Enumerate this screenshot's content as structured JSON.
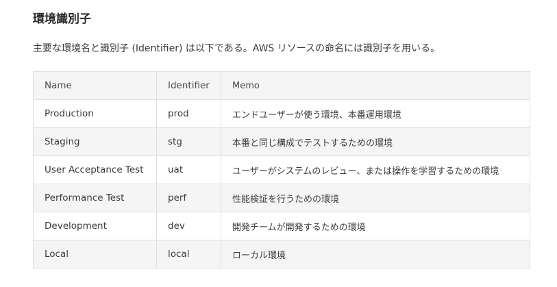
{
  "section": {
    "title": "環境識別子",
    "intro": "主要な環境名と識別子 (Identifier) は以下である。AWS リソースの命名には識別子を用いる。"
  },
  "table": {
    "headers": [
      "Name",
      "Identifier",
      "Memo"
    ],
    "rows": [
      {
        "name": "Production",
        "identifier": "prod",
        "memo": "エンドユーザーが使う環境、本番運用環境"
      },
      {
        "name": "Staging",
        "identifier": "stg",
        "memo": "本番と同じ構成でテストするための環境"
      },
      {
        "name": "User Acceptance Test",
        "identifier": "uat",
        "memo": "ユーザーがシステムのレビュー、または操作を学習するための環境"
      },
      {
        "name": "Performance Test",
        "identifier": "perf",
        "memo": "性能検証を行うための環境"
      },
      {
        "name": "Development",
        "identifier": "dev",
        "memo": "開発チームが開発するための環境"
      },
      {
        "name": "Local",
        "identifier": "local",
        "memo": "ローカル環境"
      }
    ]
  }
}
